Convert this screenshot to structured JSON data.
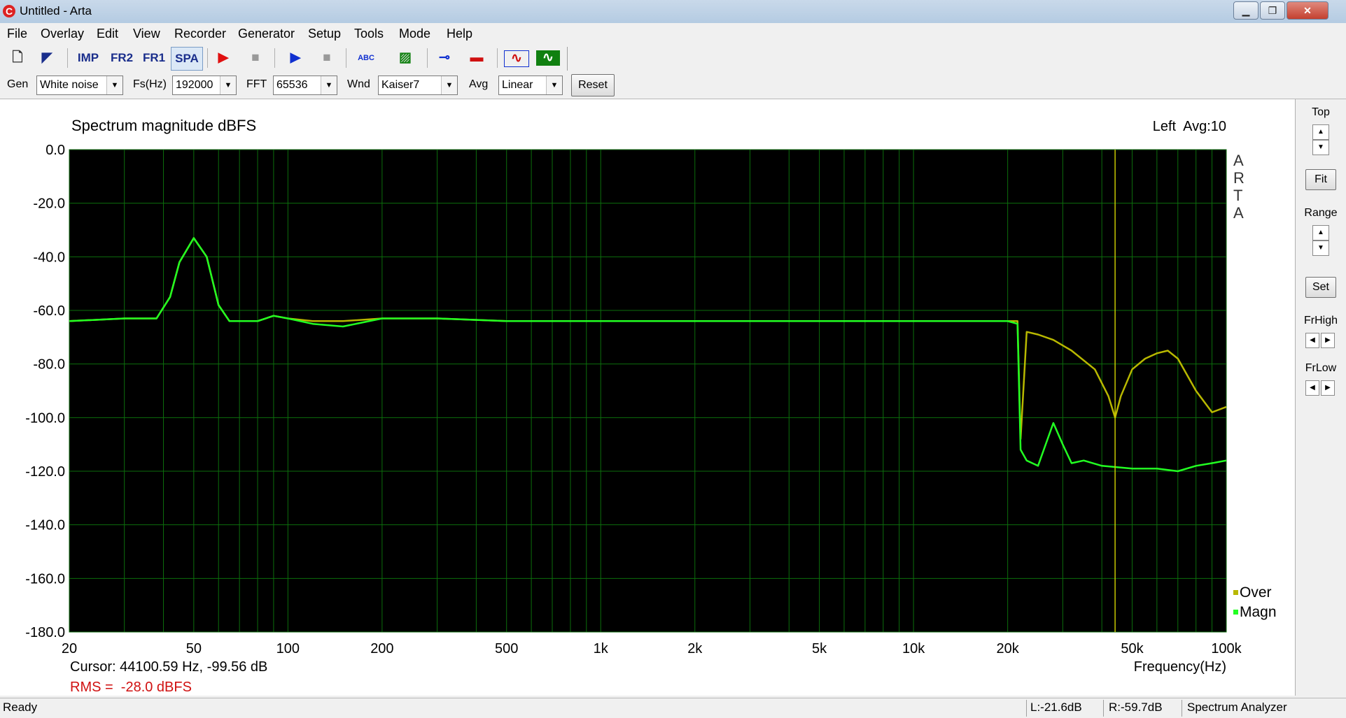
{
  "window": {
    "title": "Untitled - Arta",
    "controls": {
      "minimize": "▁",
      "maximize": "❐",
      "close": "✕"
    }
  },
  "menu": [
    "File",
    "Overlay",
    "Edit",
    "View",
    "Recorder",
    "Generator",
    "Setup",
    "Tools",
    "Mode",
    "Help"
  ],
  "toolbar": {
    "buttons": [
      {
        "name": "new-icon",
        "glyph": "🗋"
      },
      {
        "name": "open-icon",
        "glyph": "◤"
      },
      {
        "name": "imp-mode-button",
        "glyph": "IMP"
      },
      {
        "name": "fr2-mode-button",
        "glyph": "FR2"
      },
      {
        "name": "fr1-mode-button",
        "glyph": "FR1"
      },
      {
        "name": "spa-mode-button",
        "glyph": "SPA"
      },
      {
        "name": "record-play-icon",
        "glyph": "▶"
      },
      {
        "name": "record-stop-icon",
        "glyph": "■"
      },
      {
        "name": "generator-play-icon",
        "glyph": "▶"
      },
      {
        "name": "generator-stop-icon",
        "glyph": "■"
      },
      {
        "name": "text-icon",
        "glyph": "ABC"
      },
      {
        "name": "hatch-icon",
        "glyph": "▨"
      },
      {
        "name": "probe-icon",
        "glyph": "⊸"
      },
      {
        "name": "level-icon",
        "glyph": "▬"
      },
      {
        "name": "scope-icon",
        "glyph": "∿"
      },
      {
        "name": "spectrum-icon",
        "glyph": "∿"
      }
    ]
  },
  "params": {
    "gen_label": "Gen",
    "gen_value": "White noise",
    "fs_label": "Fs(Hz)",
    "fs_value": "192000",
    "fft_label": "FFT",
    "fft_value": "65536",
    "wnd_label": "Wnd",
    "wnd_value": "Kaiser7",
    "avg_label": "Avg",
    "avg_value": "Linear",
    "reset_label": "Reset"
  },
  "plot": {
    "title": "Spectrum magnitude dBFS",
    "channel_info": "Left  Avg:10",
    "watermark": [
      "A",
      "R",
      "T",
      "A"
    ],
    "cursor_text": "Cursor: 44100.59 Hz, -99.56 dB",
    "rms_text": "RMS =  -28.0 dBFS",
    "xlabel": "Frequency(Hz)"
  },
  "chart_data": {
    "type": "line",
    "title": "Spectrum magnitude dBFS",
    "xlabel": "Frequency(Hz)",
    "ylabel": "",
    "x_scale": "log",
    "xlim": [
      20,
      100000
    ],
    "ylim": [
      -180,
      0
    ],
    "x_ticks": [
      {
        "v": 20,
        "label": "20"
      },
      {
        "v": 50,
        "label": "50"
      },
      {
        "v": 100,
        "label": "100"
      },
      {
        "v": 200,
        "label": "200"
      },
      {
        "v": 500,
        "label": "500"
      },
      {
        "v": 1000,
        "label": "1k"
      },
      {
        "v": 2000,
        "label": "2k"
      },
      {
        "v": 5000,
        "label": "5k"
      },
      {
        "v": 10000,
        "label": "10k"
      },
      {
        "v": 20000,
        "label": "20k"
      },
      {
        "v": 50000,
        "label": "50k"
      },
      {
        "v": 100000,
        "label": "100k"
      }
    ],
    "y_ticks": [
      0,
      -20,
      -40,
      -60,
      -80,
      -100,
      -120,
      -140,
      -160,
      -180
    ],
    "y_tick_labels": [
      "0.0",
      "-20.0",
      "-40.0",
      "-60.0",
      "-80.0",
      "-100.0",
      "-120.0",
      "-140.0",
      "-160.0",
      "-180.0"
    ],
    "grid": true,
    "legend_position": "bottom-right",
    "cursor_frequency": 44100.59,
    "cursor_color": "#c8c800",
    "series": [
      {
        "name": "Over",
        "color": "#b8b800",
        "x": [
          20,
          30,
          38,
          42,
          45,
          50,
          55,
          60,
          65,
          70,
          80,
          90,
          100,
          120,
          150,
          200,
          250,
          300,
          500,
          1000,
          2000,
          5000,
          10000,
          20000,
          21500,
          22000,
          23000,
          25000,
          28000,
          32000,
          38000,
          42000,
          44100,
          46000,
          50000,
          55000,
          60000,
          65000,
          70000,
          80000,
          90000,
          100000
        ],
        "y": [
          -64,
          -63,
          -63,
          -55,
          -42,
          -33,
          -40,
          -58,
          -64,
          -64,
          -64,
          -62,
          -63,
          -64,
          -64,
          -63,
          -63,
          -63,
          -64,
          -64,
          -64,
          -64,
          -64,
          -64,
          -64,
          -108,
          -68,
          -69,
          -71,
          -75,
          -82,
          -92,
          -100,
          -92,
          -82,
          -78,
          -76,
          -75,
          -78,
          -90,
          -98,
          -96
        ]
      },
      {
        "name": "Magn",
        "color": "#22ff22",
        "x": [
          20,
          30,
          38,
          42,
          45,
          50,
          55,
          60,
          65,
          70,
          80,
          90,
          100,
          120,
          150,
          200,
          250,
          300,
          500,
          1000,
          2000,
          5000,
          10000,
          20000,
          21500,
          22000,
          23000,
          25000,
          28000,
          30000,
          32000,
          35000,
          40000,
          50000,
          60000,
          70000,
          80000,
          90000,
          100000
        ],
        "y": [
          -64,
          -63,
          -63,
          -55,
          -42,
          -33,
          -40,
          -58,
          -64,
          -64,
          -64,
          -62,
          -63,
          -65,
          -66,
          -63,
          -63,
          -63,
          -64,
          -64,
          -64,
          -64,
          -64,
          -64,
          -65,
          -112,
          -116,
          -118,
          -102,
          -110,
          -117,
          -116,
          -118,
          -119,
          -119,
          -120,
          -118,
          -117,
          -116
        ]
      }
    ]
  },
  "right_panel": {
    "top_label": "Top",
    "fit_label": "Fit",
    "range_label": "Range",
    "set_label": "Set",
    "frhigh_label": "FrHigh",
    "frlow_label": "FrLow"
  },
  "status": {
    "ready": "Ready",
    "left_level": "L:-21.6dB",
    "right_level": "R:-59.7dB",
    "mode": "Spectrum Analyzer"
  }
}
